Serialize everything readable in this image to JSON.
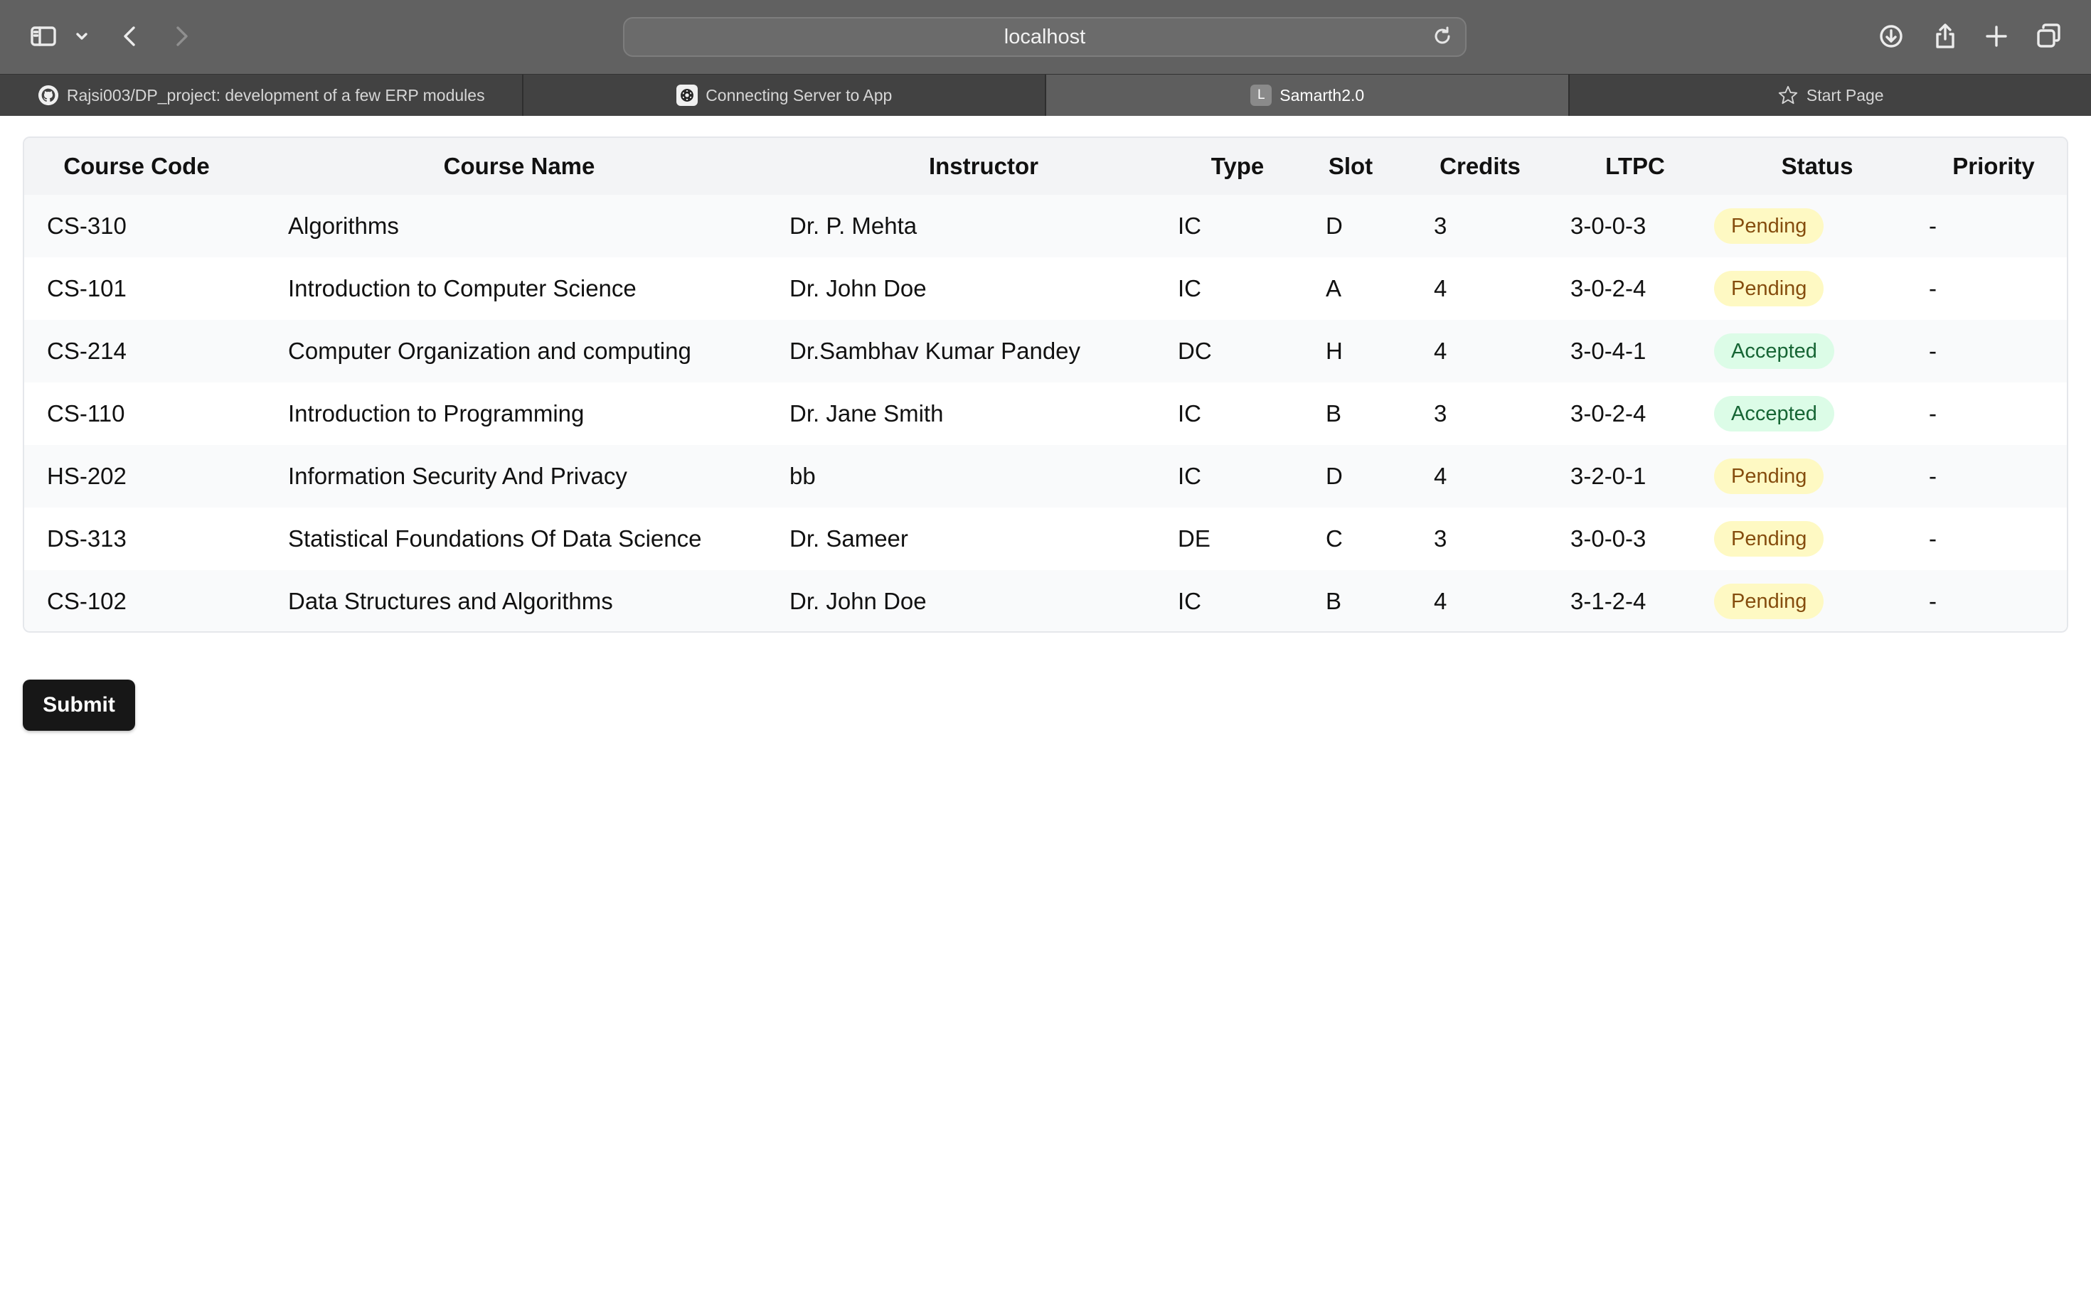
{
  "browser": {
    "url": "localhost",
    "tabs": [
      {
        "label": "Rajsi003/DP_project: development of a few ERP modules",
        "icon": "github-icon",
        "active": false
      },
      {
        "label": "Connecting Server to App",
        "icon": "openai-icon",
        "active": false
      },
      {
        "label": "Samarth2.0",
        "icon": "letter-icon",
        "icon_letter": "L",
        "active": true
      },
      {
        "label": "Start Page",
        "icon": "star-icon",
        "active": false
      }
    ],
    "icons": [
      "sidebar-icon",
      "chevron-down-icon",
      "back-icon",
      "forward-icon",
      "reload-icon",
      "download-icon",
      "share-icon",
      "new-tab-icon",
      "tab-overview-icon"
    ]
  },
  "table": {
    "headers": [
      "Course Code",
      "Course Name",
      "Instructor",
      "Type",
      "Slot",
      "Credits",
      "LTPC",
      "Status",
      "Priority"
    ],
    "rows": [
      {
        "code": "CS-310",
        "name": "Algorithms",
        "instructor": "Dr. P. Mehta",
        "type": "IC",
        "slot": "D",
        "credits": "3",
        "ltpc": "3-0-0-3",
        "status": "Pending",
        "priority": "-"
      },
      {
        "code": "CS-101",
        "name": "Introduction to Computer Science",
        "instructor": "Dr. John Doe",
        "type": "IC",
        "slot": "A",
        "credits": "4",
        "ltpc": "3-0-2-4",
        "status": "Pending",
        "priority": "-"
      },
      {
        "code": "CS-214",
        "name": "Computer Organization and computing",
        "instructor": "Dr.Sambhav Kumar Pandey",
        "type": "DC",
        "slot": "H",
        "credits": "4",
        "ltpc": "3-0-4-1",
        "status": "Accepted",
        "priority": "-"
      },
      {
        "code": "CS-110",
        "name": "Introduction to Programming",
        "instructor": "Dr. Jane Smith",
        "type": "IC",
        "slot": "B",
        "credits": "3",
        "ltpc": "3-0-2-4",
        "status": "Accepted",
        "priority": "-"
      },
      {
        "code": "HS-202",
        "name": "Information Security And Privacy",
        "instructor": "bb",
        "type": "IC",
        "slot": "D",
        "credits": "4",
        "ltpc": "3-2-0-1",
        "status": "Pending",
        "priority": "-"
      },
      {
        "code": "DS-313",
        "name": "Statistical Foundations Of Data Science",
        "instructor": "Dr. Sameer",
        "type": "DE",
        "slot": "C",
        "credits": "3",
        "ltpc": "3-0-0-3",
        "status": "Pending",
        "priority": "-"
      },
      {
        "code": "CS-102",
        "name": "Data Structures and Algorithms",
        "instructor": "Dr. John Doe",
        "type": "IC",
        "slot": "B",
        "credits": "4",
        "ltpc": "3-1-2-4",
        "status": "Pending",
        "priority": "-"
      }
    ]
  },
  "actions": {
    "submit_label": "Submit"
  },
  "colors": {
    "pending_bg": "#fef9c3",
    "pending_text": "#854d0e",
    "accepted_bg": "#dcfce7",
    "accepted_text": "#166534",
    "button_bg": "#171717"
  }
}
